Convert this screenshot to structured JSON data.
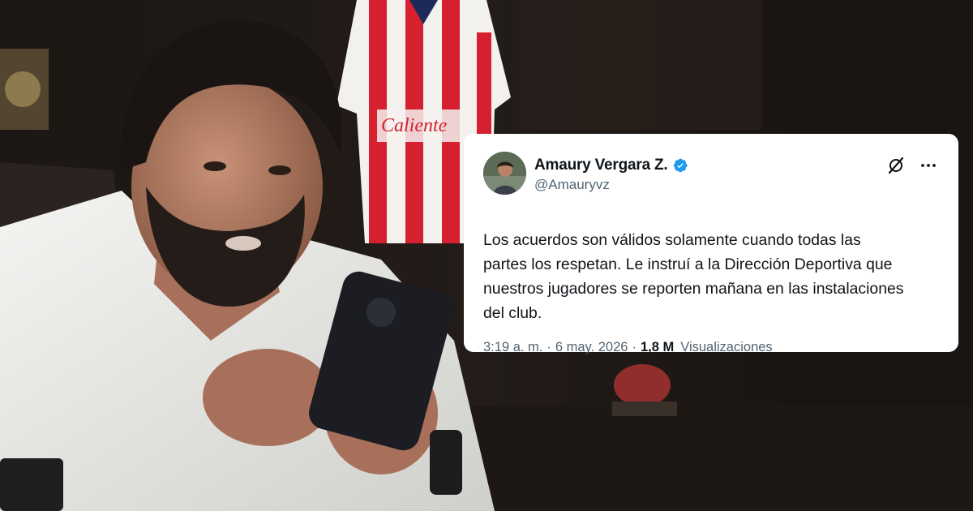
{
  "tweet": {
    "display_name": "Amaury Vergara Z.",
    "handle": "@Amauryvz",
    "verified": true,
    "text_lines": [
      "Los acuerdos son válidos solamente cuando todas las",
      "partes los respetan. Le instruí a la Dirección Deportiva que",
      "nuestros jugadores se reporten mañana en las instalaciones",
      "del club."
    ],
    "time": "3:19 a. m.",
    "date": "6 may. 2026",
    "separator": "·",
    "views_count": "1,8 M",
    "views_label": "Visualizaciones",
    "icons": {
      "verified": "verified-badge-icon",
      "brand": "x-logo-icon",
      "more": "more-icon"
    }
  },
  "background": {
    "description_icons": [
      "person-photo",
      "red-white-jersey",
      "trophy"
    ],
    "jersey_text": "Caliente"
  },
  "colors": {
    "card_bg": "#ffffff",
    "text_primary": "#0f1419",
    "text_secondary": "#536471",
    "verified_blue": "#1d9bf0",
    "jersey_red": "#d6202f"
  }
}
